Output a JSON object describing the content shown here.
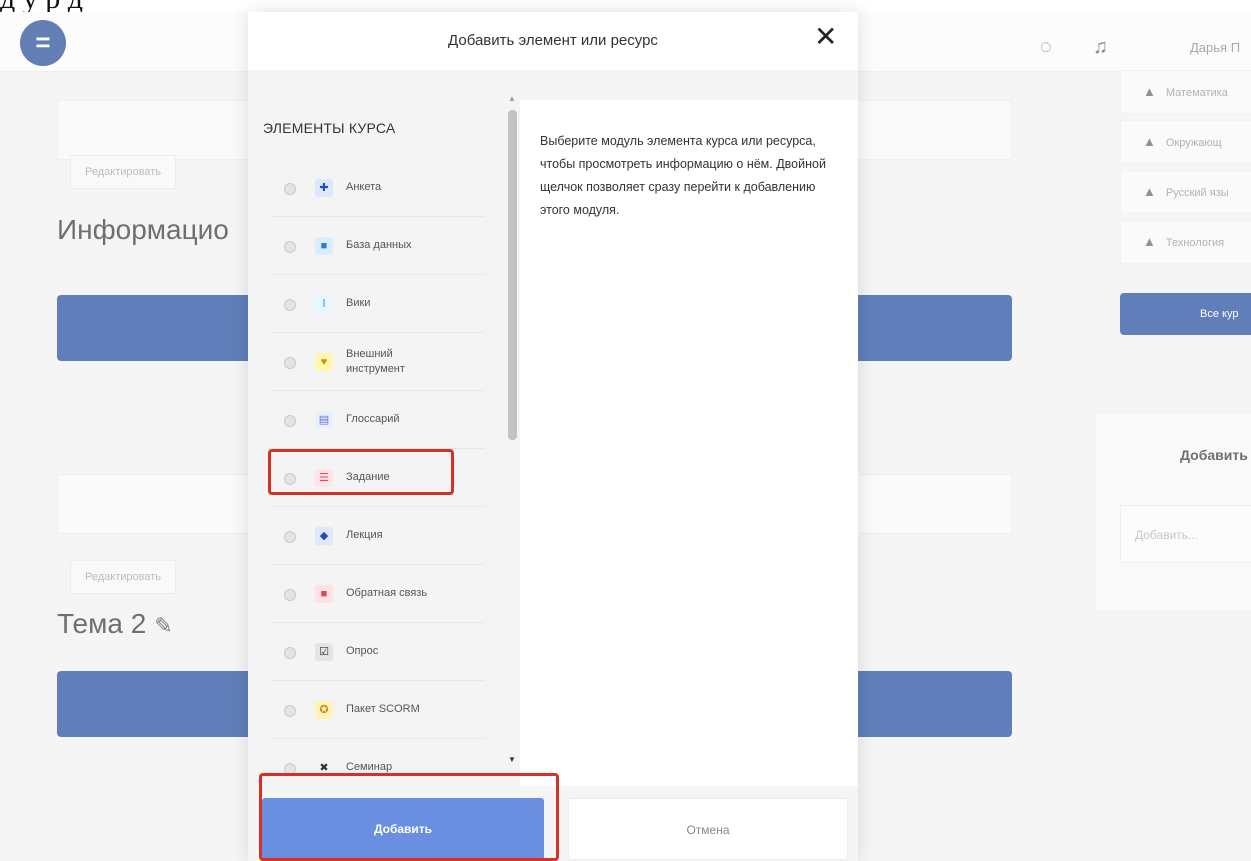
{
  "caption": "д                                                                                 у              р              д",
  "navbar": {
    "menu_icon": "hamburger-icon",
    "user_name": "Дарья П"
  },
  "background": {
    "edit_label_1": "Редактировать",
    "section_title_1": "Информацио",
    "edit_label_2": "Редактировать",
    "section_title_2": "Тема 2",
    "right_courses": [
      "Математика",
      "Окружающ",
      "Русский язы",
      "Технология"
    ],
    "right_all_courses": "Все кур",
    "right_block_title": "Добавить",
    "right_block_placeholder": "Добавить..."
  },
  "modal": {
    "title": "Добавить элемент или ресурс",
    "close_label": "✕",
    "section_heading": "ЭЛЕМЕНТЫ КУРСА",
    "items": [
      {
        "label": "Анкета",
        "icon": "survey-icon",
        "color": "#dfe8fb",
        "glyph": "✚",
        "glyph_color": "#1d4fc2"
      },
      {
        "label": "База данных",
        "icon": "database-icon",
        "color": "#dcecff",
        "glyph": "■",
        "glyph_color": "#2e7bd6"
      },
      {
        "label": "Вики",
        "icon": "wiki-icon",
        "color": "#e8f6ff",
        "glyph": "Ⅰ",
        "glyph_color": "#3aa0d8"
      },
      {
        "label": "Внешний инструмент",
        "icon": "external-tool-icon",
        "color": "#fff6b0",
        "glyph": "♥",
        "glyph_color": "#c99a00"
      },
      {
        "label": "Глоссарий",
        "icon": "glossary-icon",
        "color": "#ebf0ff",
        "glyph": "▤",
        "glyph_color": "#5b73d8"
      },
      {
        "label": "Задание",
        "icon": "assignment-icon",
        "color": "#ffe3e6",
        "glyph": "☰",
        "glyph_color": "#e0465a"
      },
      {
        "label": "Лекция",
        "icon": "lesson-icon",
        "color": "#dfe8fb",
        "glyph": "◆",
        "glyph_color": "#1d4fc2"
      },
      {
        "label": "Обратная связь",
        "icon": "feedback-icon",
        "color": "#ffe0e3",
        "glyph": "■",
        "glyph_color": "#e0465a"
      },
      {
        "label": "Опрос",
        "icon": "choice-icon",
        "color": "#e4e4e4",
        "glyph": "☑",
        "glyph_color": "#333"
      },
      {
        "label": "Пакет SCORM",
        "icon": "scorm-icon",
        "color": "#fff3b8",
        "glyph": "✪",
        "glyph_color": "#c8891a"
      },
      {
        "label": "Семинар",
        "icon": "workshop-icon",
        "color": "#f4f4f4",
        "glyph": "✖",
        "glyph_color": "#333"
      }
    ],
    "description": "Выберите модуль элемента курса или ресурса, чтобы просмотреть информацию о нём. Двойной щелчок позволяет сразу перейти к добавлению этого модуля.",
    "add_label": "Добавить",
    "cancel_label": "Отмена"
  },
  "colors": {
    "brand_blue": "#0c3a94",
    "add_button": "#6b8fe0",
    "highlight_red": "#d93025"
  }
}
